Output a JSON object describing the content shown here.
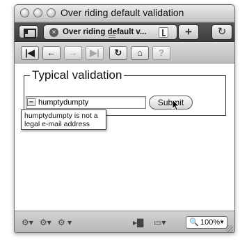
{
  "window": {
    "title": "Over riding default validation"
  },
  "tab": {
    "title": "Over riding default v...",
    "close_glyph": "×",
    "new_tab_glyph": "+",
    "history_glyph": "↻"
  },
  "nav": {
    "first_glyph": "|◀",
    "back_glyph": "←",
    "forward_glyph": "→",
    "last_glyph": "▶|",
    "reload_glyph": "↻",
    "home_glyph": "⌂",
    "help_glyph": "?"
  },
  "form": {
    "legend": "Typical validation",
    "email_value": "humptydumpty",
    "submit_label": "Submit",
    "validation_message": "humptydumpty is not a legal e-mail address"
  },
  "status": {
    "zoom_value": "100%",
    "zoom_arrow": "▼",
    "search_glyph": "🔍",
    "icons": [
      "⚙▾",
      "⚙▾",
      "⚙ ▾",
      "▸▇",
      "▭▾"
    ]
  },
  "colors": {
    "tabbar_bg": "#4a4a4a",
    "chrome_bg": "#d3d3d3"
  }
}
